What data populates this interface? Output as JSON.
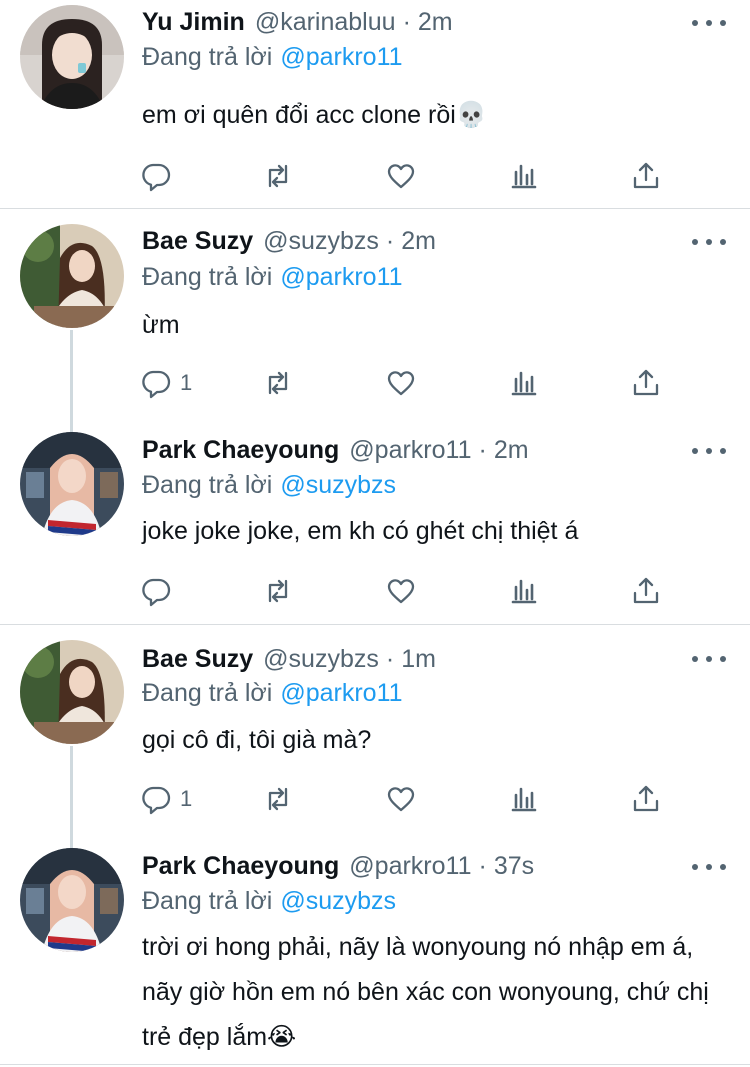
{
  "tweets": [
    {
      "name": "Yu Jimin",
      "handle": "@karinabluu",
      "time": "2m",
      "reply_prefix": "Đang trả lời",
      "reply_to": "@parkro11",
      "text": "em ơi quên đổi acc clone rồi💀",
      "reply_count": ""
    },
    {
      "name": "Bae Suzy",
      "handle": "@suzybzs",
      "time": "2m",
      "reply_prefix": "Đang trả lời",
      "reply_to": "@parkro11",
      "text": "ừm",
      "reply_count": "1"
    },
    {
      "name": "Park Chaeyoung",
      "handle": "@parkro11",
      "time": "2m",
      "reply_prefix": "Đang trả lời",
      "reply_to": "@suzybzs",
      "text": "joke joke joke, em kh có ghét chị thiệt á",
      "reply_count": ""
    },
    {
      "name": "Bae Suzy",
      "handle": "@suzybzs",
      "time": "1m",
      "reply_prefix": "Đang trả lời",
      "reply_to": "@parkro11",
      "text": "gọi cô đi, tôi già mà?",
      "reply_count": "1"
    },
    {
      "name": "Park Chaeyoung",
      "handle": "@parkro11",
      "time": "37s",
      "reply_prefix": "Đang trả lời",
      "reply_to": "@suzybzs",
      "text": "trời ơi hong phải, nãy là wonyoung nó nhập em á, nãy giờ hồn em nó bên xác con wonyoung, chứ chị trẻ đẹp lắm😭",
      "reply_count": ""
    }
  ],
  "colors": {
    "text": "#0f1419",
    "secondary": "#536471",
    "mention": "#1d9bf0",
    "divider": "#d9dde0",
    "thread_line": "#cfd9de"
  },
  "icons": [
    "reply-icon",
    "retweet-icon",
    "like-icon",
    "stats-icon",
    "share-icon",
    "more-icon"
  ]
}
